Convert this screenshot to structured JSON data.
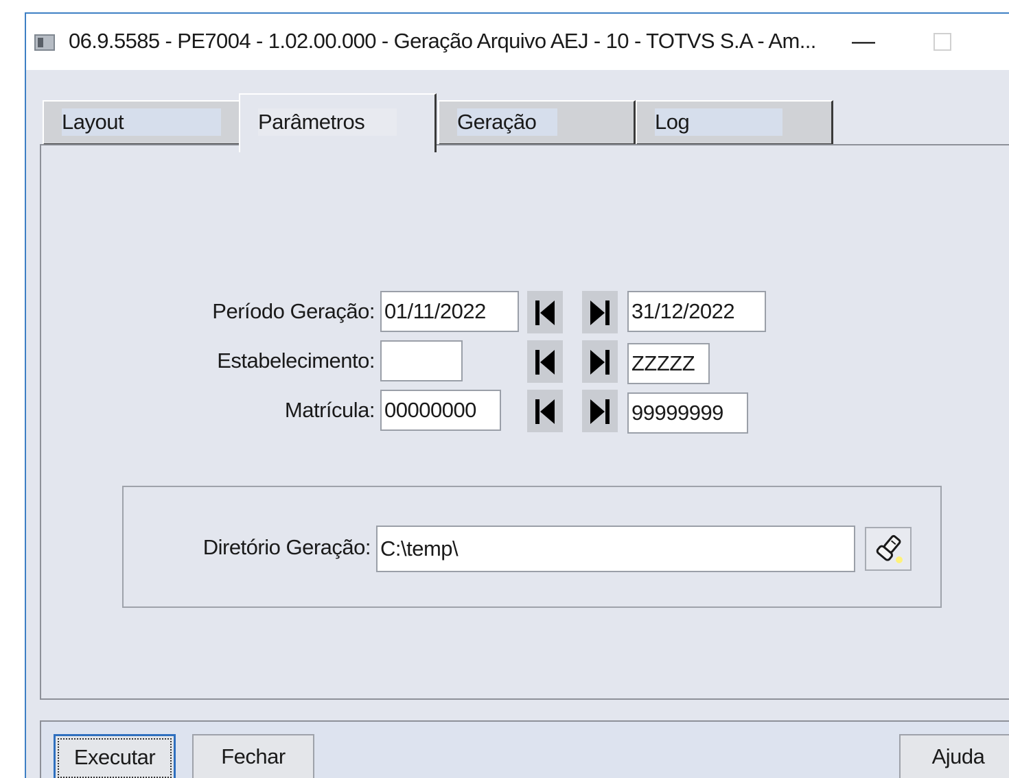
{
  "window": {
    "title": "06.9.5585 - PE7004 - 1.02.00.000 - Geração Arquivo AEJ - 10 - TOTVS S.A - Am...",
    "minimize_label": "—"
  },
  "tabs": [
    {
      "label": "Layout",
      "active": false
    },
    {
      "label": "Parâmetros",
      "active": true
    },
    {
      "label": "Geração",
      "active": false
    },
    {
      "label": "Log",
      "active": false
    }
  ],
  "params": {
    "periodo": {
      "label": "Período Geração:",
      "from": "01/11/2022",
      "to": "31/12/2022"
    },
    "estabelecimento": {
      "label": "Estabelecimento:",
      "from": "",
      "to": "ZZZZZ"
    },
    "matricula": {
      "label": "Matrícula:",
      "from": "00000000",
      "to": "99999999"
    }
  },
  "directory": {
    "label": "Diretório Geração:",
    "value": "C:\\temp\\",
    "browse_icon": "flashlight-icon"
  },
  "buttons": {
    "execute": "Executar",
    "close": "Fechar",
    "help": "Ajuda"
  },
  "icons": {
    "first": "first-record-icon",
    "last": "last-record-icon"
  }
}
